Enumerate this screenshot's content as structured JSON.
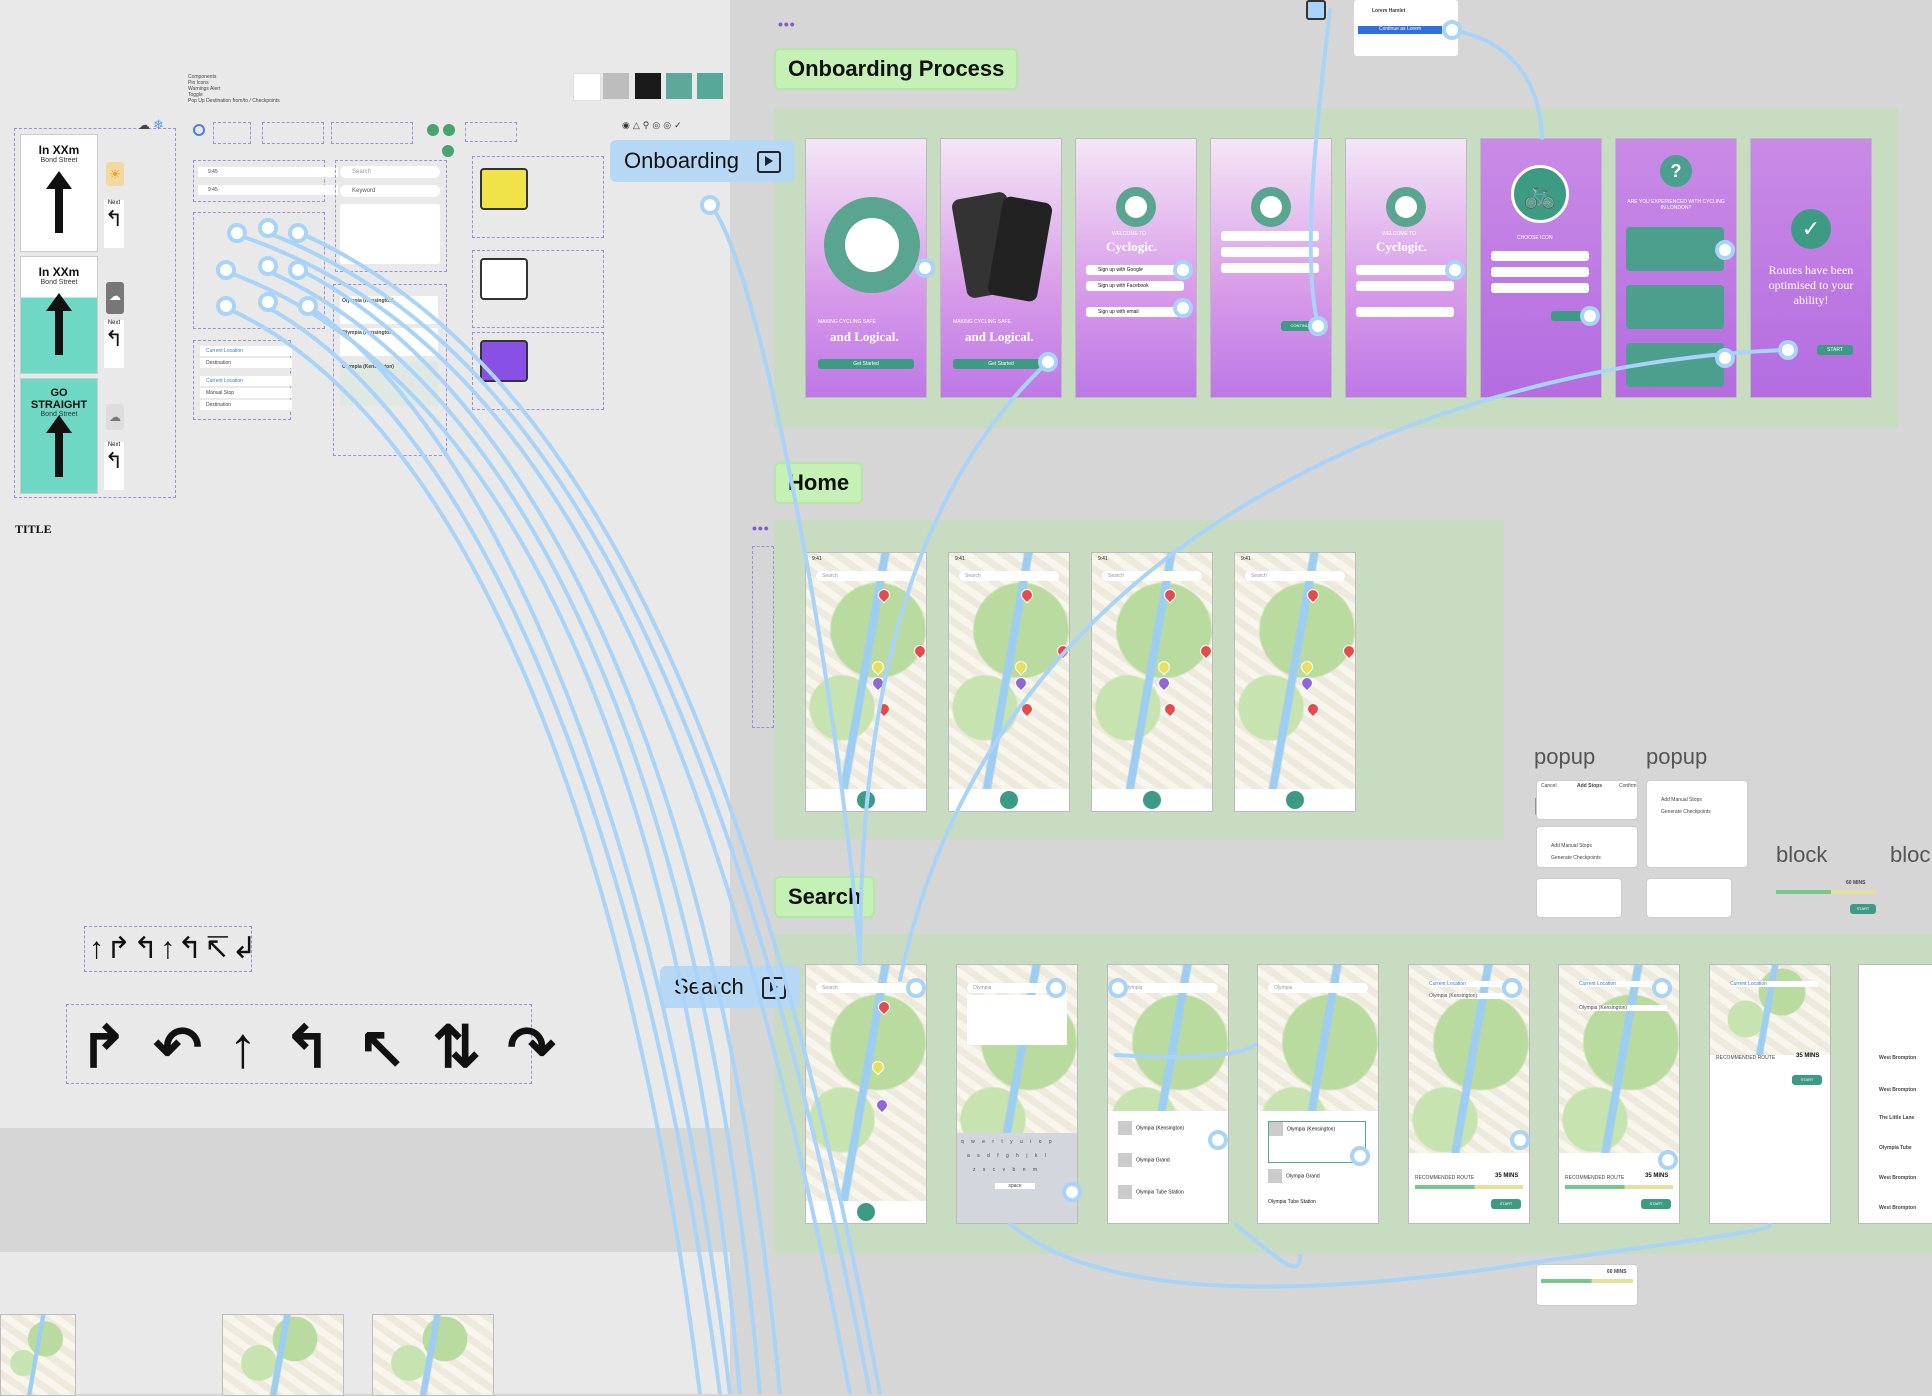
{
  "left_panel": {
    "components_note": [
      "Components",
      "Pin Icons",
      "Warnings Alert",
      "Toggle",
      "Pop Up Destination from/to / Checkpoints"
    ],
    "sign_cards": [
      {
        "title": "In XXm",
        "street": "Bond Street",
        "next": "Next"
      },
      {
        "title": "In XXm",
        "street": "Bond Street",
        "next": "Next"
      },
      {
        "title": "GO STRAIGHT",
        "street": "Bond Street",
        "next": "Next"
      }
    ],
    "title_label": "TITLE",
    "status_times": [
      "9:45",
      "9:45"
    ],
    "search_placeholder": "Search",
    "keyword_placeholder": "Keyword",
    "results": [
      "Olympia (Kensington)",
      "Olympia (Kensington)",
      "Olympia (Kensington)"
    ],
    "route_inputs": [
      "Current Location",
      "Destination",
      "Current Location",
      "Manual Stop",
      "Destination"
    ]
  },
  "colors": {
    "swatches": [
      "#ffffff",
      "#bdbdbd",
      "#1a1a1a",
      "#5ea899",
      "#56a898"
    ],
    "accent": "#3d9b83",
    "link_line": "#a9d3f7"
  },
  "sections": {
    "onboarding_process": "Onboarding Process",
    "home": "Home",
    "search": "Search"
  },
  "flows": {
    "onboarding": "Onboarding",
    "search": "Search"
  },
  "onboarding_screens": {
    "tagline_1": "MAKING CYCLING SAFE",
    "tagline_2": "and Logical.",
    "get_started": "Get Started",
    "welcome": "WELCOME TO",
    "brand": "Cyclogic.",
    "sign_google": "Sign up with Google",
    "sign_facebook": "Sign up with Facebook",
    "sign_email": "Sign up with email",
    "choose_icon": "CHOOSE ICON",
    "question": "ARE YOU EXPERIENCED WITH CYCLING IN LONDON?",
    "optimised": "Routes have been optimised to your ability!",
    "start": "START",
    "continue": "CONTINUE"
  },
  "home_screens": {
    "search_placeholder": "Search"
  },
  "search_screens": {
    "query": "Olympia",
    "results": [
      "Olympia (Kensington)",
      "Olympia Grand",
      "Olympia Tube Station"
    ],
    "current_location": "Current Location",
    "destination": "Olympia (Kensington)",
    "recommended_route": "RECOMMENDED ROUTE",
    "eta": "35 MINS",
    "start": "START",
    "keyboard_rows": [
      "q w e r t y u i o p",
      "a s d f g h j k l",
      "z x c v b n m"
    ],
    "space": "space",
    "side_list": [
      "West Brompton",
      "West Brompton",
      "The Little Lane",
      "Olympia Tube",
      "West Brompton",
      "West Brompton"
    ]
  },
  "annotations": {
    "popup": "popup",
    "block": "block",
    "popup_tabs": [
      "Cancel",
      "Add Stops",
      "Confirm"
    ],
    "popup_options": [
      "Add Manual Stops",
      "Generate Checkpoints"
    ],
    "block_eta": "60 MINS",
    "block_start": "START"
  },
  "comment_card": {
    "name": "Lorem Hamlet",
    "action": "Continue as Lorem"
  }
}
